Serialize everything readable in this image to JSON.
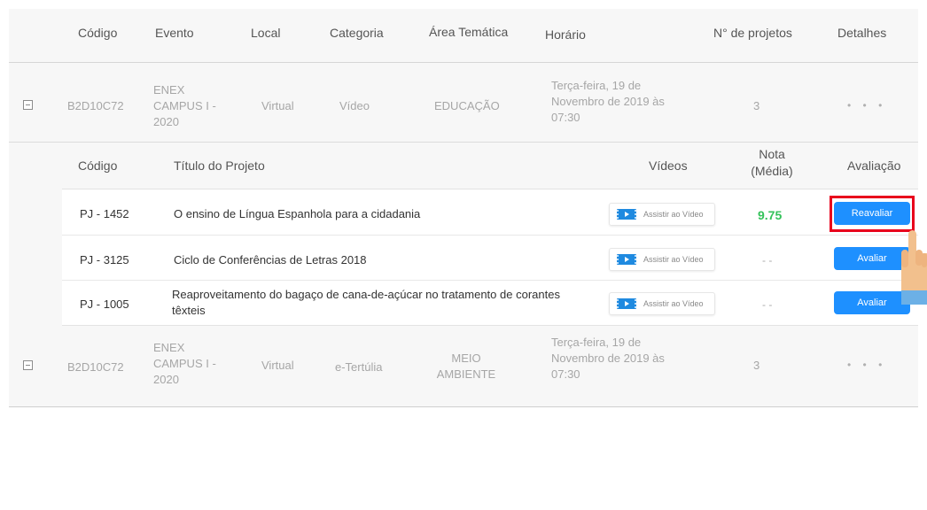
{
  "header": {
    "codigo": "Código",
    "evento": "Evento",
    "local": "Local",
    "categoria": "Categoria",
    "area": "Área Temática",
    "horario": "Horário",
    "nprojetos": "N° de projetos",
    "detalhes": "Detalhes"
  },
  "events": [
    {
      "codigo": "B2D10C72",
      "evento": [
        "ENEX",
        "CAMPUS I -",
        "2020"
      ],
      "local": "Virtual",
      "categoria": "Vídeo",
      "area": [
        "EDUCAÇÃO"
      ],
      "horario": [
        "Terça-feira, 19 de",
        "Novembro de 2019 às",
        "07:30"
      ],
      "nprojetos": "3",
      "detalhes": "• • •"
    },
    {
      "codigo": "B2D10C72",
      "evento": [
        "ENEX",
        "CAMPUS I -",
        "2020"
      ],
      "local": "Virtual",
      "categoria": "e-Tertúlia",
      "area": [
        "MEIO",
        "AMBIENTE"
      ],
      "horario": [
        "Terça-feira, 19 de",
        "Novembro de 2019 às",
        "07:30"
      ],
      "nprojetos": "3",
      "detalhes": "• • •"
    }
  ],
  "projects_header": {
    "codigo": "Código",
    "titulo": "Título do Projeto",
    "videos": "Vídeos",
    "nota_line1": "Nota",
    "nota_line2": "(Média)",
    "avaliacao": "Avaliação"
  },
  "projects": [
    {
      "codigo": "PJ - 1452",
      "titulo": [
        "O ensino de Língua Espanhola para a cidadania"
      ],
      "video_label": "Assistir ao Vídeo",
      "nota": "9.75",
      "action": "Reavaliar"
    },
    {
      "codigo": "PJ - 3125",
      "titulo": [
        "Ciclo de Conferências de Letras 2018"
      ],
      "video_label": "Assistir ao Vídeo",
      "nota": "- -",
      "action": "Avaliar"
    },
    {
      "codigo": "PJ - 1005",
      "titulo": [
        "Reaproveitamento do bagaço de cana-de-açúcar no tratamento de corantes",
        "têxteis"
      ],
      "video_label": "Assistir ao Vídeo",
      "nota": "- -",
      "action": "Avaliar"
    }
  ],
  "colors": {
    "accent": "#1e90ff",
    "score_green": "#34c25a",
    "highlight_red": "#e8001c"
  },
  "icons": {
    "pointer": "hand-pointer-icon",
    "video": "video-film-icon",
    "expander": "collapse-minus-icon"
  }
}
